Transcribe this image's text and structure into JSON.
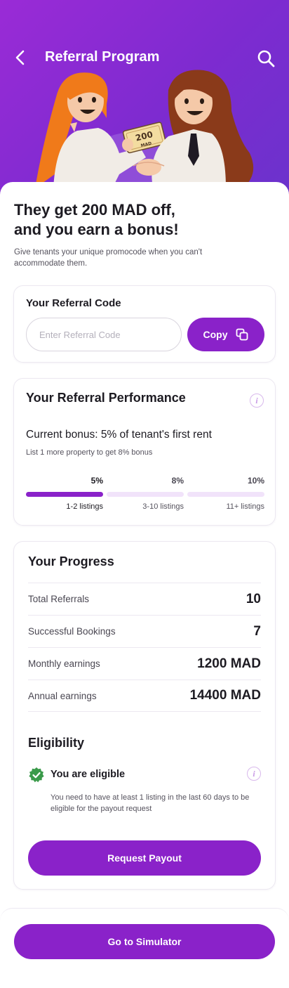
{
  "header": {
    "title": "Referral Program",
    "back_icon": "chevron-left-icon",
    "search_icon": "search-icon",
    "gradient": [
      "#9a2bd6",
      "#6a33cc"
    ]
  },
  "illustration": {
    "note_amount": "200",
    "note_currency": "MAD"
  },
  "intro": {
    "headline_line1": "They get 200 MAD off,",
    "headline_line2": "and you earn a bonus!",
    "subtext": "Give tenants your unique promocode when you can't accommodate them."
  },
  "referral_code": {
    "label": "Your Referral Code",
    "value": "",
    "placeholder": "Enter Referral Code",
    "copy_label": "Copy",
    "copy_icon": "copy-icon"
  },
  "performance": {
    "title": "Your Referral Performance",
    "info_icon": "info-icon",
    "current_bonus": "Current bonus: 5% of tenant's first rent",
    "hint": "List 1 more property to get 8% bonus",
    "tiers": [
      {
        "percent": "5%",
        "range": "1-2 listings",
        "active": true
      },
      {
        "percent": "8%",
        "range": "3-10 listings",
        "active": false
      },
      {
        "percent": "10%",
        "range": "11+ listings",
        "active": false
      }
    ]
  },
  "progress": {
    "title": "Your Progress",
    "rows": [
      {
        "label": "Total Referrals",
        "value": "10"
      },
      {
        "label": "Successful Bookings",
        "value": "7"
      },
      {
        "label": "Monthly earnings",
        "value": "1200 MAD"
      },
      {
        "label": "Annual earnings",
        "value": "14400 MAD"
      }
    ]
  },
  "eligibility": {
    "title": "Eligibility",
    "status": "You are eligible",
    "status_icon": "check-badge-icon",
    "status_color": "#3a9a4a",
    "description": "You need to have at least 1 listing in the last 60 days to be eligible for the payout request",
    "payout_label": "Request Payout"
  },
  "footer": {
    "simulator_label": "Go to Simulator"
  },
  "colors": {
    "accent": "#8a22c9",
    "accent_light": "#f1e3fa"
  }
}
